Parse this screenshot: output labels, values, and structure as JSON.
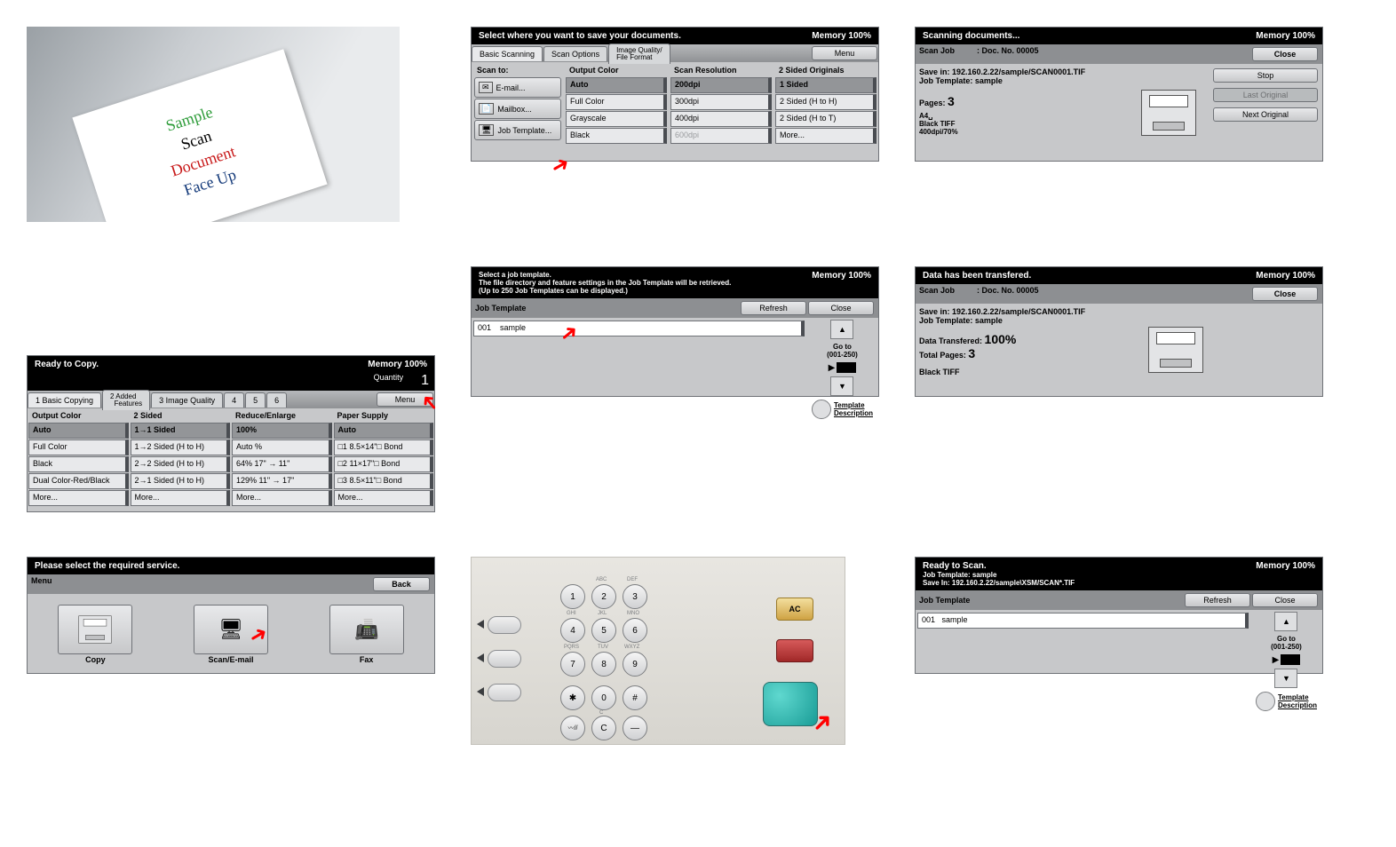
{
  "memory": "Memory 100%",
  "photo": {
    "l1": "Sample",
    "l2": "Scan",
    "l3": "Document",
    "l4": "Face Up"
  },
  "scanTo": {
    "title": "Select where you want to save your documents.",
    "tabs": [
      "Basic Scanning",
      "Scan Options",
      "Image Quality/\nFile Format"
    ],
    "menu": "Menu",
    "scanToLabel": "Scan to:",
    "email": "E-mail...",
    "mailbox": "Mailbox...",
    "jobTemplate": "Job Template...",
    "outputColorHdr": "Output Color",
    "scanResHdr": "Scan Resolution",
    "twoSidedHdr": "2 Sided Originals",
    "outputColor": [
      "Auto",
      "Full Color",
      "Grayscale",
      "Black"
    ],
    "scanRes": [
      "200dpi",
      "300dpi",
      "400dpi",
      "600dpi"
    ],
    "twoSided": [
      "1 Sided",
      "2 Sided (H to H)",
      "2 Sided (H to T)",
      "More..."
    ]
  },
  "scanning": {
    "title": "Scanning documents...",
    "jobBar": "Scan Job          : Doc. No. 00005",
    "close": "Close",
    "saveIn": "Save in: 192.160.2.22/sample/SCAN0001.TIF",
    "template": "Job Template: sample",
    "pages": "Pages:",
    "pagesN": "3",
    "meta": "A4␣\nBlack TIFF\n400dpi/70%",
    "stop": "Stop",
    "last": "Last Original",
    "next": "Next Original"
  },
  "copy": {
    "title": "Ready to Copy.",
    "qty": "Quantity",
    "qtyN": "1",
    "tabs": [
      "1 Basic Copying",
      "2 Added\n  Features",
      "3 Image Quality",
      "4",
      "5",
      "6"
    ],
    "menu": "Menu",
    "hA": "Output Color",
    "hB": "2 Sided",
    "hC": "Reduce/Enlarge",
    "hD": "Paper Supply",
    "a": [
      "Auto",
      "Full Color",
      "Black",
      "Dual Color-Red/Black",
      "More..."
    ],
    "b": [
      "1→1 Sided",
      "1→2 Sided (H to H)",
      "2→2 Sided (H to H)",
      "2→1 Sided (H to H)",
      "More..."
    ],
    "c": [
      "100%",
      "Auto %",
      "64%  17\" → 11\"",
      "129% 11\" → 17\"",
      "More..."
    ],
    "d": [
      "Auto",
      "□1  8.5×14\"□     Bond",
      "□2  11×17\"□     Bond",
      "□3  8.5×11\"□    Bond",
      "More..."
    ]
  },
  "selectTpl": {
    "title": "Select a job template.\nThe file directory and feature settings in the Job Template will be retrieved.\n(Up to 250 Job Templates can be displayed.)",
    "bar": "Job Template",
    "refresh": "Refresh",
    "close": "Close",
    "row": "001    sample",
    "goto": "Go to",
    "range": "(001-250)",
    "desc": "Template\nDescription"
  },
  "transfer": {
    "title": "Data has been transfered.",
    "jobBar": "Scan Job          : Doc. No. 00005",
    "close": "Close",
    "saveIn": "Save in: 192.160.2.22/sample/SCAN0001.TIF",
    "template": "Job Template: sample",
    "done": "Data Transfered:",
    "doneN": "100%",
    "total": "Total Pages:",
    "totalN": "3",
    "fmt": "Black TIFF"
  },
  "service": {
    "title": "Please select the required service.",
    "menu": "Menu",
    "back": "Back",
    "copy": "Copy",
    "scan": "Scan/E-mail",
    "fax": "Fax"
  },
  "keypad": {
    "ac": "AC"
  },
  "ready": {
    "title": "Ready to Scan.",
    "template": "Job Template: sample",
    "saveIn": "Save In: 192.160.2.22/sample\\XSM/SCAN*.TIF",
    "bar": "Job Template",
    "refresh": "Refresh",
    "close": "Close",
    "row": "001   sample",
    "goto": "Go to",
    "range": "(001-250)",
    "desc": "Template\nDescription"
  }
}
